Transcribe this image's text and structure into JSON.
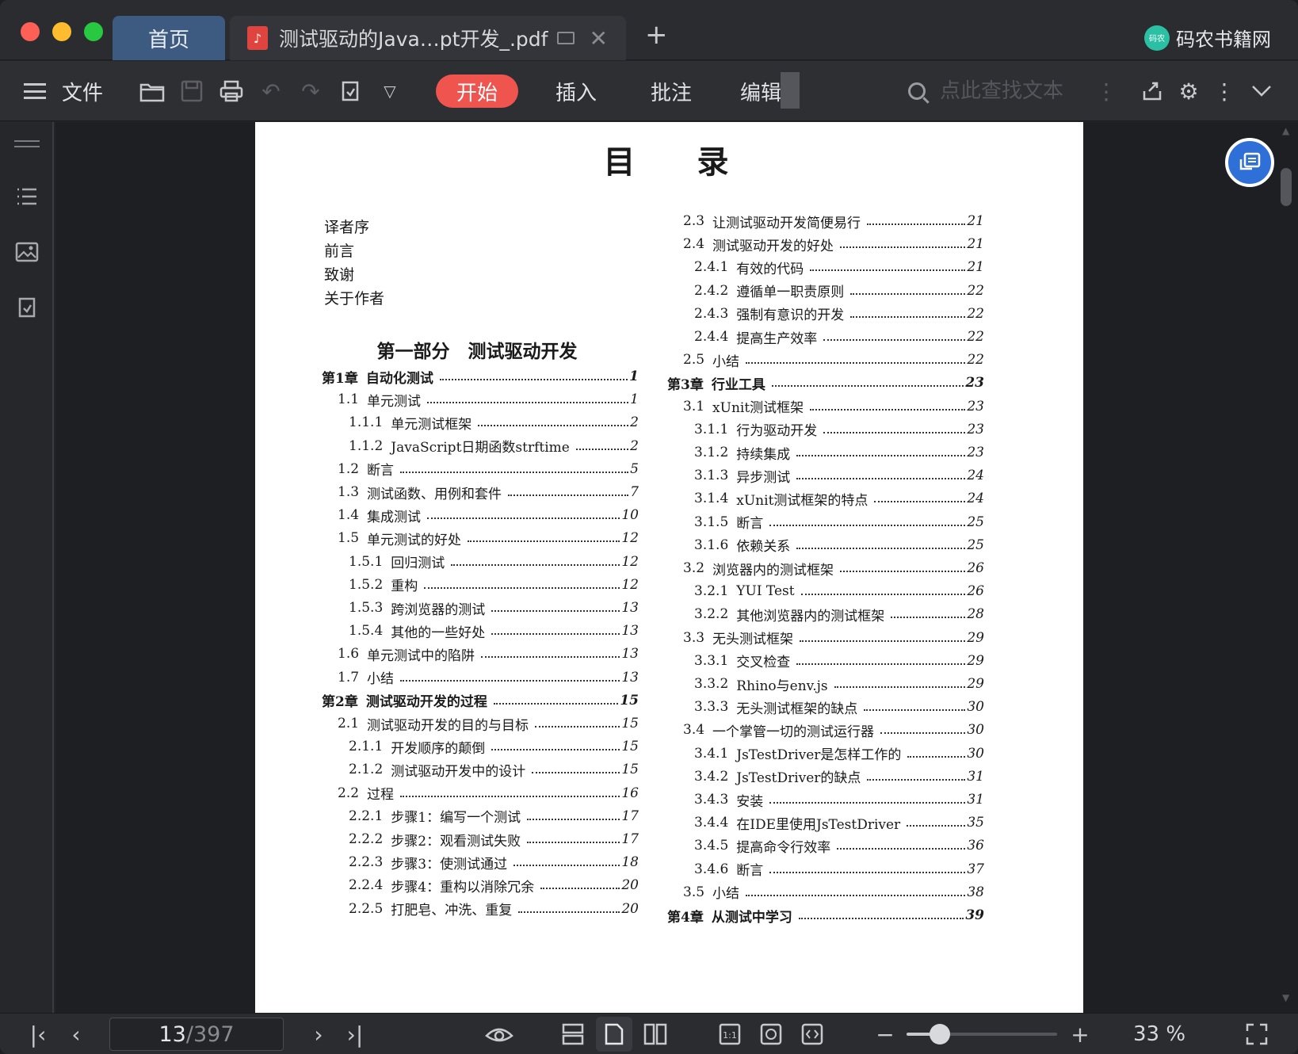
{
  "tabs": {
    "home": "首页",
    "document": "测试驱动的Java…pt开发_.pdf",
    "new_tab": "+"
  },
  "brand": {
    "name": "码农书籍网",
    "logo_text": "码农"
  },
  "toolbar": {
    "file": "文件",
    "tabs": [
      "开始",
      "插入",
      "批注",
      "编辑"
    ],
    "active_tab": "开始",
    "search_placeholder": "点此查找文本",
    "accent": "#f0544f"
  },
  "document": {
    "title": "目录",
    "front_matter": [
      "译者序",
      "前言",
      "致谢",
      "关于作者"
    ],
    "part_title": "第一部分　测试驱动开发",
    "left_column": [
      {
        "num": "第1章",
        "text": "自动化测试",
        "page": "1",
        "level": 0
      },
      {
        "num": "1.1",
        "text": "单元测试",
        "page": "1",
        "level": 1
      },
      {
        "num": "1.1.1",
        "text": "单元测试框架",
        "page": "2",
        "level": 2
      },
      {
        "num": "1.1.2",
        "text": "JavaScript日期函数strftime",
        "page": "2",
        "level": 2
      },
      {
        "num": "1.2",
        "text": "断言",
        "page": "5",
        "level": 1
      },
      {
        "num": "1.3",
        "text": "测试函数、用例和套件",
        "page": "7",
        "level": 1
      },
      {
        "num": "1.4",
        "text": "集成测试",
        "page": "10",
        "level": 1
      },
      {
        "num": "1.5",
        "text": "单元测试的好处",
        "page": "12",
        "level": 1
      },
      {
        "num": "1.5.1",
        "text": "回归测试",
        "page": "12",
        "level": 2
      },
      {
        "num": "1.5.2",
        "text": "重构",
        "page": "12",
        "level": 2
      },
      {
        "num": "1.5.3",
        "text": "跨浏览器的测试",
        "page": "13",
        "level": 2
      },
      {
        "num": "1.5.4",
        "text": "其他的一些好处",
        "page": "13",
        "level": 2
      },
      {
        "num": "1.6",
        "text": "单元测试中的陷阱",
        "page": "13",
        "level": 1
      },
      {
        "num": "1.7",
        "text": "小结",
        "page": "13",
        "level": 1
      },
      {
        "num": "第2章",
        "text": "测试驱动开发的过程",
        "page": "15",
        "level": 0
      },
      {
        "num": "2.1",
        "text": "测试驱动开发的目的与目标",
        "page": "15",
        "level": 1
      },
      {
        "num": "2.1.1",
        "text": "开发顺序的颠倒",
        "page": "15",
        "level": 2
      },
      {
        "num": "2.1.2",
        "text": "测试驱动开发中的设计",
        "page": "15",
        "level": 2
      },
      {
        "num": "2.2",
        "text": "过程",
        "page": "16",
        "level": 1
      },
      {
        "num": "2.2.1",
        "text": "步骤1：编写一个测试",
        "page": "17",
        "level": 2
      },
      {
        "num": "2.2.2",
        "text": "步骤2：观看测试失败",
        "page": "17",
        "level": 2
      },
      {
        "num": "2.2.3",
        "text": "步骤3：使测试通过",
        "page": "18",
        "level": 2
      },
      {
        "num": "2.2.4",
        "text": "步骤4：重构以消除冗余",
        "page": "20",
        "level": 2
      },
      {
        "num": "2.2.5",
        "text": "打肥皂、冲洗、重复",
        "page": "20",
        "level": 2
      }
    ],
    "right_column": [
      {
        "num": "2.3",
        "text": "让测试驱动开发简便易行",
        "page": "21",
        "level": 1
      },
      {
        "num": "2.4",
        "text": "测试驱动开发的好处",
        "page": "21",
        "level": 1
      },
      {
        "num": "2.4.1",
        "text": "有效的代码",
        "page": "21",
        "level": 2
      },
      {
        "num": "2.4.2",
        "text": "遵循单一职责原则",
        "page": "22",
        "level": 2
      },
      {
        "num": "2.4.3",
        "text": "强制有意识的开发",
        "page": "22",
        "level": 2
      },
      {
        "num": "2.4.4",
        "text": "提高生产效率",
        "page": "22",
        "level": 2
      },
      {
        "num": "2.5",
        "text": "小结",
        "page": "22",
        "level": 1
      },
      {
        "num": "第3章",
        "text": "行业工具",
        "page": "23",
        "level": 0
      },
      {
        "num": "3.1",
        "text": "xUnit测试框架",
        "page": "23",
        "level": 1
      },
      {
        "num": "3.1.1",
        "text": "行为驱动开发",
        "page": "23",
        "level": 2
      },
      {
        "num": "3.1.2",
        "text": "持续集成",
        "page": "23",
        "level": 2
      },
      {
        "num": "3.1.3",
        "text": "异步测试",
        "page": "24",
        "level": 2
      },
      {
        "num": "3.1.4",
        "text": "xUnit测试框架的特点",
        "page": "24",
        "level": 2
      },
      {
        "num": "3.1.5",
        "text": "断言",
        "page": "25",
        "level": 2
      },
      {
        "num": "3.1.6",
        "text": "依赖关系",
        "page": "25",
        "level": 2
      },
      {
        "num": "3.2",
        "text": "浏览器内的测试框架",
        "page": "26",
        "level": 1
      },
      {
        "num": "3.2.1",
        "text": "YUI Test",
        "page": "26",
        "level": 2
      },
      {
        "num": "3.2.2",
        "text": "其他浏览器内的测试框架",
        "page": "28",
        "level": 2
      },
      {
        "num": "3.3",
        "text": "无头测试框架",
        "page": "29",
        "level": 1
      },
      {
        "num": "3.3.1",
        "text": "交叉检查",
        "page": "29",
        "level": 2
      },
      {
        "num": "3.3.2",
        "text": "Rhino与env.js",
        "page": "29",
        "level": 2
      },
      {
        "num": "3.3.3",
        "text": "无头测试框架的缺点",
        "page": "30",
        "level": 2
      },
      {
        "num": "3.4",
        "text": "一个掌管一切的测试运行器",
        "page": "30",
        "level": 1
      },
      {
        "num": "3.4.1",
        "text": "JsTestDriver是怎样工作的",
        "page": "30",
        "level": 2
      },
      {
        "num": "3.4.2",
        "text": "JsTestDriver的缺点",
        "page": "31",
        "level": 2
      },
      {
        "num": "3.4.3",
        "text": "安装",
        "page": "31",
        "level": 2
      },
      {
        "num": "3.4.4",
        "text": "在IDE里使用JsTestDriver",
        "page": "35",
        "level": 2
      },
      {
        "num": "3.4.5",
        "text": "提高命令行效率",
        "page": "36",
        "level": 2
      },
      {
        "num": "3.4.6",
        "text": "断言",
        "page": "37",
        "level": 2
      },
      {
        "num": "3.5",
        "text": "小结",
        "page": "38",
        "level": 1
      },
      {
        "num": "第4章",
        "text": "从测试中学习",
        "page": "39",
        "level": 0
      }
    ]
  },
  "status": {
    "current_page": "13",
    "total_pages": "/397",
    "zoom": "33 %",
    "zoom_fraction": 0.22
  }
}
